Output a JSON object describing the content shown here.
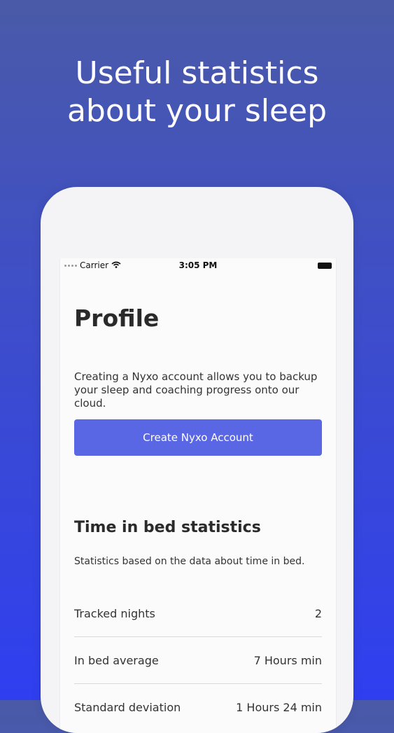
{
  "headline": {
    "line1": "Useful statistics",
    "line2": "about your sleep"
  },
  "status_bar": {
    "carrier": "Carrier",
    "time": "3:05 PM",
    "icons": [
      "signal-dots-icon",
      "wifi-icon",
      "battery-icon"
    ]
  },
  "profile": {
    "title": "Profile",
    "description": "Creating a Nyxo account allows you to backup your sleep and coaching progress onto our cloud.",
    "cta_label": "Create Nyxo Account"
  },
  "time_in_bed": {
    "title": "Time in bed statistics",
    "description": "Statistics based on the data about time in bed.",
    "rows": [
      {
        "label": "Tracked nights",
        "value": "2"
      },
      {
        "label": "In bed average",
        "value": "7 Hours  min"
      },
      {
        "label": "Standard deviation",
        "value": "1 Hours 24 min"
      }
    ]
  },
  "colors": {
    "background_top": "#4a5aa8",
    "background_bottom": "#2f3ff0",
    "primary_button": "#5a67e5"
  }
}
